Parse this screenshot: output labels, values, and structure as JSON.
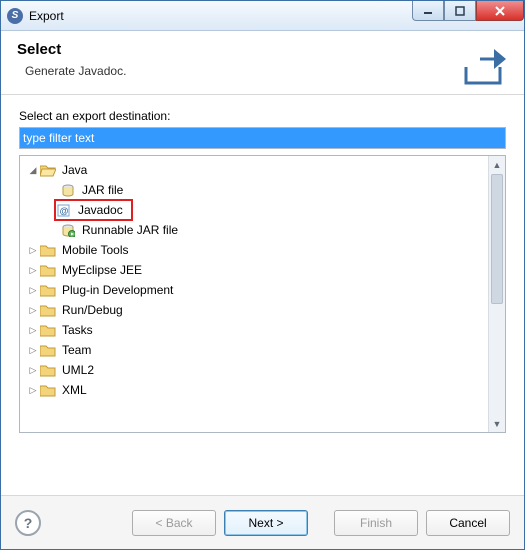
{
  "window": {
    "title": "Export"
  },
  "header": {
    "title": "Select",
    "subtitle": "Generate Javadoc."
  },
  "content": {
    "destination_label": "Select an export destination:",
    "filter_value": "type filter text"
  },
  "tree": {
    "java": {
      "label": "Java",
      "expanded": true,
      "children": {
        "jar": "JAR file",
        "javadoc": "Javadoc",
        "runnable": "Runnable JAR file"
      }
    },
    "mobile": {
      "label": "Mobile Tools"
    },
    "jee": {
      "label": "MyEclipse JEE"
    },
    "plugin": {
      "label": "Plug-in Development"
    },
    "rundebug": {
      "label": "Run/Debug"
    },
    "tasks": {
      "label": "Tasks"
    },
    "team": {
      "label": "Team"
    },
    "uml2": {
      "label": "UML2"
    },
    "xml": {
      "label": "XML"
    }
  },
  "buttons": {
    "back": "< Back",
    "next": "Next >",
    "finish": "Finish",
    "cancel": "Cancel"
  },
  "help": {
    "symbol": "?"
  }
}
